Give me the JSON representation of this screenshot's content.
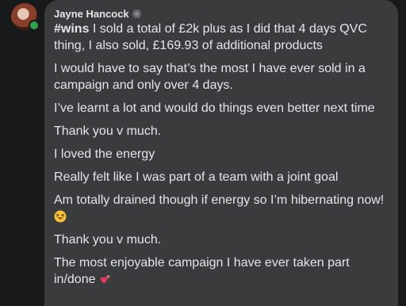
{
  "comment": {
    "author_name": "Jayne Hancock",
    "hashtag": "#wins",
    "paragraphs": [
      " I sold a total of £2k plus as I did that 4 days QVC thing, I also sold, £169.93 of additional products",
      "I would have to say that’s the most I have ever sold in a campaign and only over 4 days.",
      "I’ve learnt a lot and would do things even better next time",
      "Thank you v much.",
      "I loved the energy",
      "Really felt like I was part of a team with a joint goal",
      "Am totally drained though if energy so I’m hibernating now!",
      "Thank you v much.",
      "The most enjoyable campaign I have ever taken part in/done "
    ]
  },
  "colors": {
    "page_bg": "#18191a",
    "bubble_bg": "#3a3b3c",
    "text": "#e4e6eb",
    "online": "#31a24c"
  },
  "icons": {
    "badge": "top-fan-badge-icon",
    "emoji_1": "squinting-tongue-emoji",
    "emoji_2": "two-hearts-emoji"
  }
}
